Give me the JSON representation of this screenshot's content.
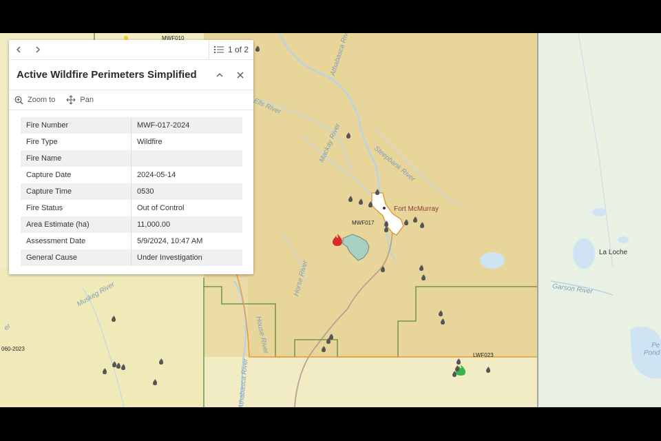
{
  "popup": {
    "nav_prev": "‹",
    "nav_next": "›",
    "pager_text": "1 of 2",
    "title": "Active Wildfire Perimeters Simplified",
    "collapse_icon": "chevron-up-icon",
    "close_icon": "close-icon",
    "actions": [
      {
        "label": "Zoom to",
        "icon": "zoom-in-icon"
      },
      {
        "label": "Pan",
        "icon": "pan-icon"
      }
    ],
    "attributes": [
      {
        "field": "Fire Number",
        "value": "MWF-017-2024"
      },
      {
        "field": "Fire Type",
        "value": "Wildfire"
      },
      {
        "field": "Fire Name",
        "value": ""
      },
      {
        "field": "Capture Date",
        "value": "2024-05-14"
      },
      {
        "field": "Capture Time",
        "value": "0530"
      },
      {
        "field": "Fire Status",
        "value": "Out of Control"
      },
      {
        "field": "Area Estimate (ha)",
        "value": "11,000.00"
      },
      {
        "field": "Assessment Date",
        "value": "5/9/2024, 10:47 AM"
      },
      {
        "field": "General Cause",
        "value": "Under Investigation"
      }
    ]
  },
  "map": {
    "place_labels": {
      "fort_mcmurray": "Fort McMurray",
      "la_loche": "La Loche",
      "pond": "Pe\nPond"
    },
    "fire_labels": {
      "mwf010": "MWF010",
      "mwf017": "MWF017",
      "lwf023": "LWF023",
      "left_060": "060-2023"
    },
    "river_labels": {
      "athabasca_top": "Athabasca River",
      "ells": "Ells River",
      "mackay": "Mackay River",
      "steepbank": "Steepbank River",
      "horse": "Horse River",
      "horse2": "House River",
      "athabasca_bottom": "Athabasca River",
      "muskeg": "Muskeg River",
      "garson": "Garson River",
      "edge": "er"
    },
    "colors": {
      "alberta_land": "#f2ecc4",
      "fire_zone_tint": "#e9d59a",
      "sask_land": "#e8f1e3",
      "river": "#b9d3e5",
      "lake": "#cfe4f3",
      "zone_boundary": "#5a8a3a",
      "orange_boundary": "#e39b3a",
      "perimeter_fill": "#a8d1c4",
      "fire_active": "#d92b2b",
      "fire_green": "#3ab54a",
      "hotspot": "#555555"
    }
  }
}
